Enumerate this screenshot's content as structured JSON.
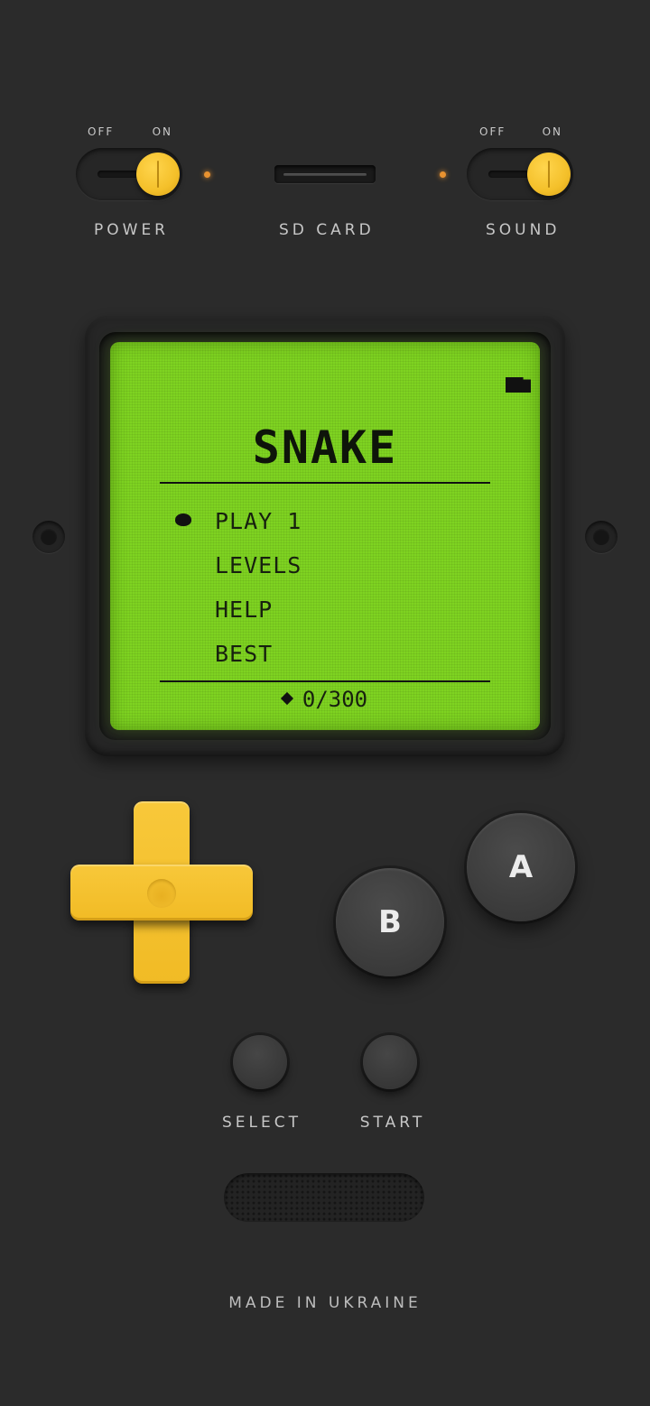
{
  "top_controls": {
    "power": {
      "off_label": "OFF",
      "on_label": "ON",
      "label": "POWER",
      "state": "on"
    },
    "sd_card": {
      "label": "SD CARD"
    },
    "sound": {
      "off_label": "OFF",
      "on_label": "ON",
      "label": "SOUND",
      "state": "on"
    }
  },
  "screen": {
    "title": "SNAKE",
    "menu_items": [
      "PLAY 1",
      "LEVELS",
      "HELP",
      "BEST"
    ],
    "selected_index": 0,
    "score": "0/300",
    "indicator_icon": "battery-icon",
    "score_icon": "diamond-icon"
  },
  "buttons": {
    "a_label": "A",
    "b_label": "B",
    "select_label": "SELECT",
    "start_label": "START"
  },
  "footer": {
    "text": "MADE IN UKRAINE"
  },
  "colors": {
    "body": "#2b2b2b",
    "accent_yellow": "#f4c02a",
    "lcd_green": "#7ed321",
    "led_orange": "#e99230"
  }
}
